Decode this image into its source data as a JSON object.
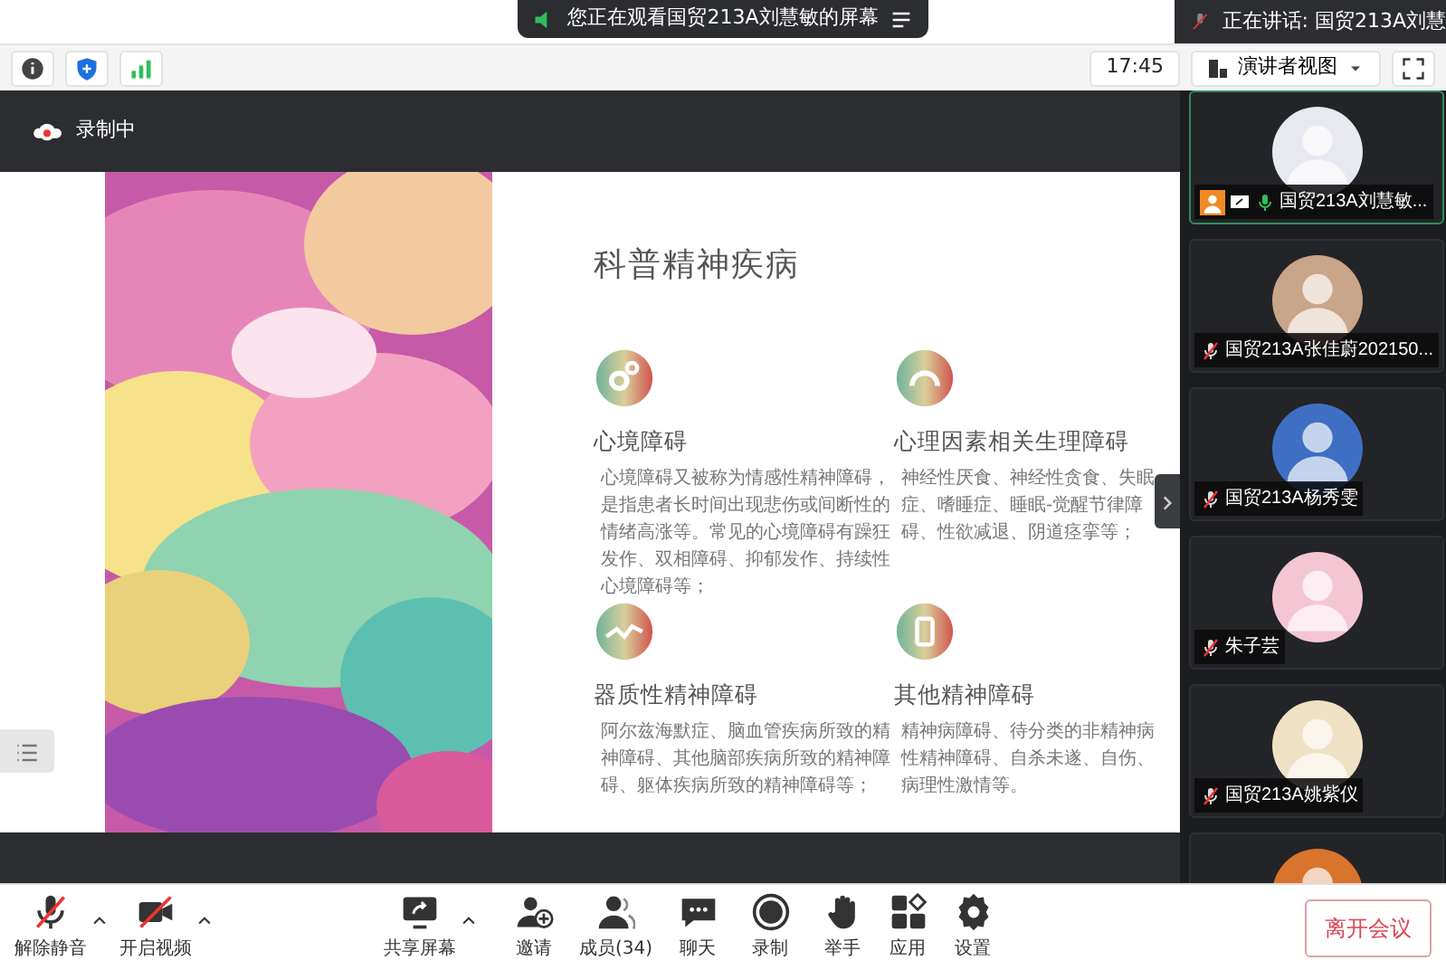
{
  "banner": {
    "text": "您正在观看国贸213A刘慧敏的屏幕"
  },
  "speaking": {
    "text": "正在讲话: 国贸213A刘慧"
  },
  "toolbar": {
    "time": "17:45",
    "view": "演讲者视图"
  },
  "recording": {
    "label": "录制中"
  },
  "slide": {
    "title": "科普精神疾病",
    "sections": [
      {
        "title": "心境障碍",
        "body": "心境障碍又被称为情感性精神障碍，是指患者长时间出现悲伤或间断性的情绪高涨等。常见的心境障碍有躁狂发作、双相障碍、抑郁发作、持续性心境障碍等；"
      },
      {
        "title": "心理因素相关生理障碍",
        "body": "神经性厌食、神经性贪食、失眠症、嗜睡症、睡眠-觉醒节律障碍、性欲减退、阴道痉挛等；"
      },
      {
        "title": "器质性精神障碍",
        "body": "阿尔兹海默症、脑血管疾病所致的精神障碍、其他脑部疾病所致的精神障碍、躯体疾病所致的精神障碍等；"
      },
      {
        "title": "其他精神障碍",
        "body": "精神病障碍、待分类的非精神病性精神障碍、自杀未遂、自伤、病理性激情等。"
      }
    ]
  },
  "participants": [
    {
      "name": "国贸213A刘慧敏...",
      "muted": false,
      "host": true,
      "speaking": true,
      "color": "#e8e8f0"
    },
    {
      "name": "国贸213A张佳蔚202150...",
      "muted": true,
      "host": false,
      "speaking": false,
      "color": "#c9a58a"
    },
    {
      "name": "国贸213A杨秀雯",
      "muted": true,
      "host": false,
      "speaking": false,
      "color": "#3f6fc2"
    },
    {
      "name": "朱子芸",
      "muted": true,
      "host": false,
      "speaking": false,
      "color": "#f4c6d4"
    },
    {
      "name": "国贸213A姚紫仪",
      "muted": true,
      "host": false,
      "speaking": false,
      "color": "#efe2c4"
    },
    {
      "speaking": false,
      "color": "#d9742c"
    }
  ],
  "controls": [
    {
      "label": "解除静音",
      "caret": true
    },
    {
      "label": "开启视频",
      "caret": true
    },
    {
      "label": "共享屏幕",
      "caret": true
    },
    {
      "label": "邀请",
      "caret": false
    },
    {
      "label": "成员(34)",
      "caret": false
    },
    {
      "label": "聊天",
      "caret": false
    },
    {
      "label": "录制",
      "caret": false
    },
    {
      "label": "举手",
      "caret": false
    },
    {
      "label": "应用",
      "caret": false
    },
    {
      "label": "设置",
      "caret": false
    }
  ],
  "leave": "离开会议"
}
